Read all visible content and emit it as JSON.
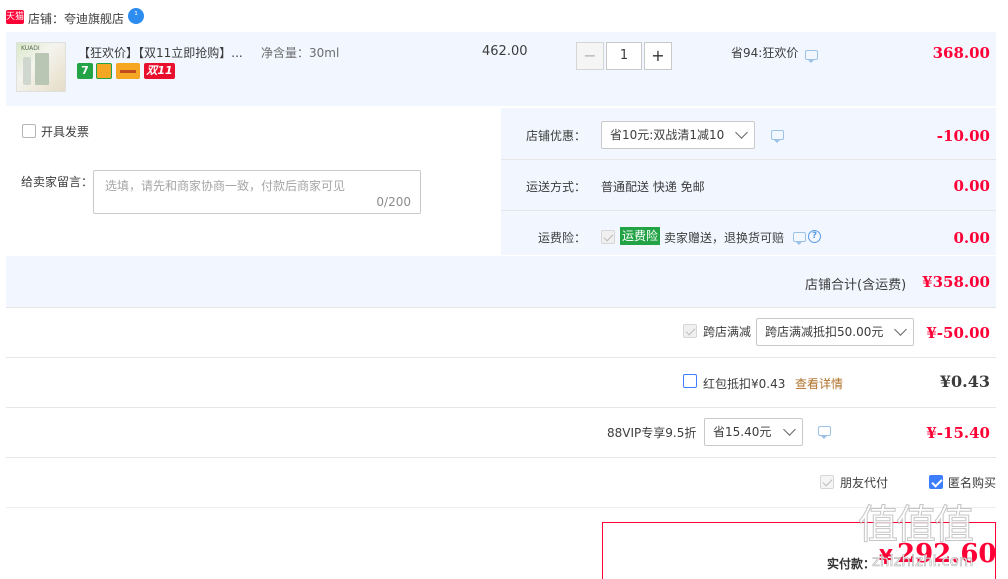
{
  "shop": {
    "platform_badge": "天猫",
    "name": "店铺：夸迪旗舰店",
    "chat_badge": "¹"
  },
  "item": {
    "title": "【狂欢价】【双11立即抢购】...",
    "spec": "净含量：30ml",
    "unit_price": "462.00",
    "quantity": "1",
    "promo": "省94:狂欢价",
    "subtotal": "368.00",
    "tags": {
      "seven": "7",
      "double11": "双11"
    },
    "thumb_text": "KUADI"
  },
  "qty": {
    "minus": "−",
    "plus": "+"
  },
  "invoice": {
    "label": "开具发票"
  },
  "message": {
    "label": "给卖家留言：",
    "placeholder": "选填，请先和商家协商一致，付款后商家可见",
    "counter": "0/200"
  },
  "shop_discount": {
    "label": "店铺优惠：",
    "selected": "省10元:双战清1减10",
    "amount": "-10.00"
  },
  "shipping": {
    "label": "运送方式：",
    "value": "普通配送 快递 免邮",
    "amount": "0.00"
  },
  "insurance": {
    "label": "运费险：",
    "badge": "运费险",
    "desc": "卖家赠送，退换货可赔",
    "amount": "0.00",
    "help": "?"
  },
  "shop_total": {
    "label": "店铺合计(含运费)",
    "amount": "¥358.00"
  },
  "cross_store": {
    "label": "跨店满减",
    "selected": "跨店满减抵扣50.00元",
    "amount": "¥-50.00"
  },
  "red_packet": {
    "label": "红包抵扣¥0.43",
    "link": "查看详情",
    "amount": "¥0.43"
  },
  "vip": {
    "label": "88VIP专享9.5折",
    "selected": "省15.40元",
    "amount": "¥-15.40"
  },
  "options": {
    "friend_pay": "朋友代付",
    "anonymous": "匿名购买"
  },
  "payment": {
    "label": "实付款：",
    "currency": "¥",
    "amount": "292.60"
  },
  "watermark": {
    "logo": "值值值",
    "site": "zhizhizhi.com"
  },
  "colors": {
    "accent_red": "#ff0036",
    "row_bg": "#f2f7ff",
    "link_brown": "#b0712a",
    "badge_green": "#22a346",
    "check_blue": "#3d7eff"
  }
}
